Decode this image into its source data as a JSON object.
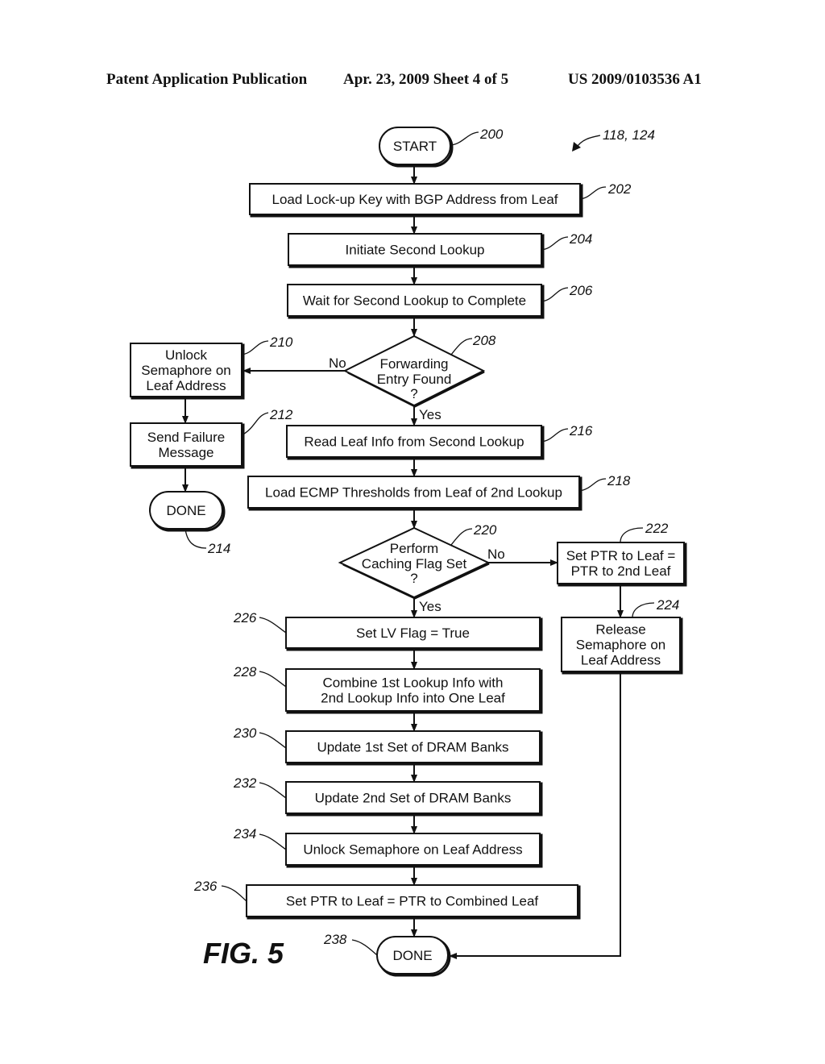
{
  "header": {
    "left": "Patent Application Publication",
    "center": "Apr. 23, 2009  Sheet 4 of 5",
    "right": "US 2009/0103536 A1"
  },
  "figure": {
    "label": "FIG. 5",
    "overall_ref": "118, 124"
  },
  "nodes": {
    "n200": {
      "ref": "200",
      "lines": [
        "START"
      ]
    },
    "n202": {
      "ref": "202",
      "lines": [
        "Load Lock-up Key with BGP Address from Leaf"
      ]
    },
    "n204": {
      "ref": "204",
      "lines": [
        "Initiate Second Lookup"
      ]
    },
    "n206": {
      "ref": "206",
      "lines": [
        "Wait for Second Lookup to Complete"
      ]
    },
    "n208": {
      "ref": "208",
      "lines": [
        "Forwarding",
        "Entry Found",
        "?"
      ]
    },
    "n210": {
      "ref": "210",
      "lines": [
        "Unlock",
        "Semaphore on",
        "Leaf Address"
      ]
    },
    "n212": {
      "ref": "212",
      "lines": [
        "Send Failure",
        "Message"
      ]
    },
    "n214": {
      "ref": "214",
      "lines": [
        "DONE"
      ]
    },
    "n216": {
      "ref": "216",
      "lines": [
        "Read Leaf Info from Second Lookup"
      ]
    },
    "n218": {
      "ref": "218",
      "lines": [
        "Load ECMP Thresholds from Leaf of 2nd Lookup"
      ]
    },
    "n220": {
      "ref": "220",
      "lines": [
        "Perform",
        "Caching Flag Set",
        "?"
      ]
    },
    "n222": {
      "ref": "222",
      "lines": [
        "Set PTR to Leaf =",
        "PTR to 2nd Leaf"
      ]
    },
    "n224": {
      "ref": "224",
      "lines": [
        "Release",
        "Semaphore on",
        "Leaf Address"
      ]
    },
    "n226": {
      "ref": "226",
      "lines": [
        "Set LV Flag = True"
      ]
    },
    "n228": {
      "ref": "228",
      "lines": [
        "Combine 1st Lookup Info with",
        "2nd Lookup Info into One Leaf"
      ]
    },
    "n230": {
      "ref": "230",
      "lines": [
        "Update 1st Set of DRAM Banks"
      ]
    },
    "n232": {
      "ref": "232",
      "lines": [
        "Update 2nd Set of DRAM Banks"
      ]
    },
    "n234": {
      "ref": "234",
      "lines": [
        "Unlock Semaphore on Leaf Address"
      ]
    },
    "n236": {
      "ref": "236",
      "lines": [
        "Set PTR to Leaf = PTR to Combined Leaf"
      ]
    },
    "n238": {
      "ref": "238",
      "lines": [
        "DONE"
      ]
    }
  },
  "edge_labels": {
    "d208_no": "No",
    "d208_yes": "Yes",
    "d220_no": "No",
    "d220_yes": "Yes"
  }
}
